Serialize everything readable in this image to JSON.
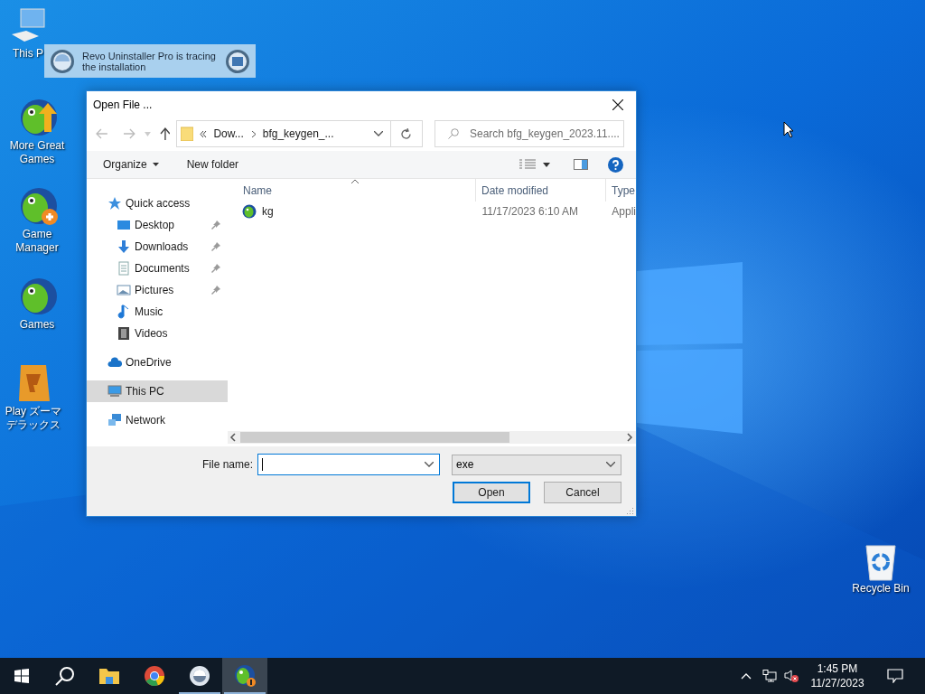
{
  "desktop_icons": [
    {
      "kind": "computer",
      "label": "This P"
    },
    {
      "kind": "fish-up",
      "label": "More Great Games"
    },
    {
      "kind": "fish-plus",
      "label": "Game Manager"
    },
    {
      "kind": "fish",
      "label": "Games"
    },
    {
      "kind": "puzzle",
      "label": "Play ズーマデラックス"
    },
    {
      "kind": "recycle",
      "label": "Recycle Bin"
    }
  ],
  "tracing_popup": {
    "text": "Revo Uninstaller Pro is tracing the installation"
  },
  "dialog": {
    "title": "Open File ...",
    "address": {
      "segments": [
        "Dow...",
        "bfg_keygen_..."
      ]
    },
    "search": {
      "placeholder": "Search bfg_keygen_2023.11...."
    },
    "toolbar": {
      "organize": "Organize",
      "new_folder": "New folder"
    },
    "sidebar": [
      {
        "kind": "star",
        "label": "Quick access",
        "selected": false,
        "children": [
          {
            "kind": "desktop",
            "label": "Desktop",
            "pinned": true,
            "selected": false
          },
          {
            "kind": "download",
            "label": "Downloads",
            "pinned": true,
            "selected": false
          },
          {
            "kind": "document",
            "label": "Documents",
            "pinned": true,
            "selected": false
          },
          {
            "kind": "pictures",
            "label": "Pictures",
            "pinned": true,
            "selected": false
          },
          {
            "kind": "music",
            "label": "Music",
            "pinned": false,
            "selected": false
          },
          {
            "kind": "video",
            "label": "Videos",
            "pinned": false,
            "selected": false
          }
        ]
      },
      {
        "kind": "cloud",
        "label": "OneDrive",
        "selected": false
      },
      {
        "kind": "pc",
        "label": "This PC",
        "selected": true
      },
      {
        "kind": "network",
        "label": "Network",
        "selected": false
      }
    ],
    "columns": [
      "Name",
      "Date modified",
      "Type"
    ],
    "rows": [
      {
        "name": "kg",
        "date": "11/17/2023 6:10 AM",
        "type": "Appli",
        "selected": false
      }
    ],
    "file_name_label": "File name:",
    "file_type": "exe",
    "buttons": [
      {
        "label": "Open",
        "default": true
      },
      {
        "label": "Cancel",
        "default": false
      }
    ]
  },
  "taskbar": {
    "apps": [
      {
        "kind": "explorer",
        "running": false,
        "active": false
      },
      {
        "kind": "chrome",
        "running": false,
        "active": false
      },
      {
        "kind": "revo",
        "running": true,
        "active": false
      },
      {
        "kind": "game",
        "running": true,
        "active": true
      }
    ],
    "time": "1:45 PM",
    "date": "11/27/2023"
  }
}
